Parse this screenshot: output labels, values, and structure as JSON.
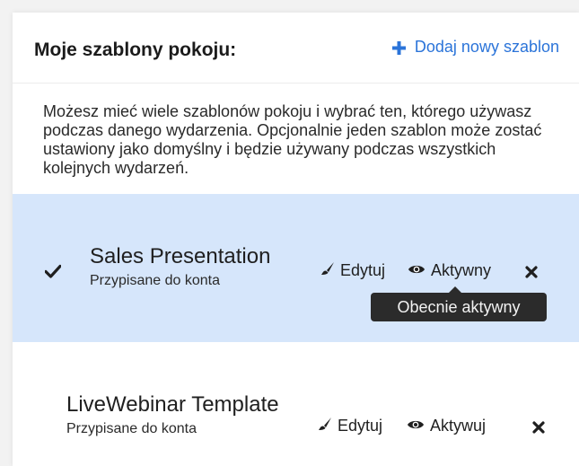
{
  "header": {
    "title": "Moje szablony pokoju:",
    "add_label": "Dodaj nowy szablon",
    "accent": "#2b74d9"
  },
  "description": "Możesz mieć wiele szablonów pokoju i wybrać ten, którego używasz podczas danego wydarzenia. Opcjonalnie jeden szablon może zostać ustawiony jako domyślny i będzie używany podczas wszystkich kolejnych wydarzeń.",
  "templates": [
    {
      "name": "Sales Presentation",
      "subtitle": "Przypisane do konta",
      "edit_label": "Edytuj",
      "status_label": "Aktywny",
      "tooltip": "Obecnie aktywny",
      "active": true,
      "highlight": "#d6e6fb",
      "icons": [
        "check-icon",
        "brush-icon",
        "eye-icon",
        "close-icon"
      ]
    },
    {
      "name": "LiveWebinar Template",
      "subtitle": "Przypisane do konta",
      "edit_label": "Edytuj",
      "status_label": "Aktywuj",
      "active": false,
      "icons": [
        "brush-icon",
        "eye-icon",
        "close-icon"
      ]
    }
  ]
}
